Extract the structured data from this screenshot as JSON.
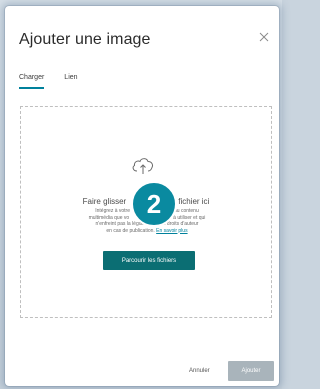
{
  "dialog": {
    "title": "Ajouter une image",
    "close_icon": "close-icon"
  },
  "tabs": [
    {
      "label": "Charger",
      "active": true
    },
    {
      "label": "Lien",
      "active": false
    }
  ],
  "dropzone": {
    "icon": "cloud-upload-icon",
    "headline_left": "Faire glisser",
    "headline_right": "fichier ici",
    "line1_left": "Intégrez à votre",
    "line1_right": "du contenu",
    "line2_left": "multimédia que vo",
    "line2_right": "à utiliser et qui",
    "line3_left": "n'enfreint pas la législ",
    "line3_right": "aux droits d'auteur",
    "line4_text": "en cas de publication.",
    "learn_more": "En savoir plus",
    "browse_label": "Parcourir les fichiers"
  },
  "badge": {
    "number": "2",
    "color": "#0a8aa0"
  },
  "footer": {
    "cancel_label": "Annuler",
    "add_label": "Ajouter"
  },
  "colors": {
    "accent": "#00819c",
    "primary_button": "#0b6e73",
    "disabled_button": "#a9b4bb"
  }
}
